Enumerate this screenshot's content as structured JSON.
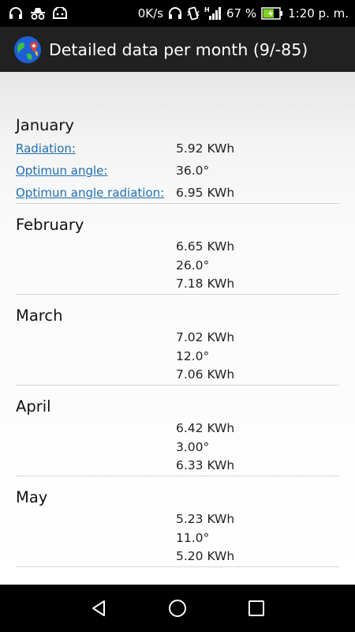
{
  "status_bar": {
    "network_speed": "0K/s",
    "battery_percent": "67 %",
    "battery_level": 0.67,
    "time": "1:20 p. m.",
    "signal_type": "H",
    "icons_left": [
      "headset-icon",
      "incognito-icon",
      "android-debug-icon"
    ],
    "icons_right": [
      "headphones-icon",
      "vibrate-icon",
      "signal-icon",
      "battery-charging-icon"
    ]
  },
  "app_bar": {
    "title": "Detailed data per month (9/-85)",
    "logo": "globe-pin-icon"
  },
  "months": [
    {
      "name": "January",
      "rows": [
        {
          "label": "Radiation:",
          "value": "5.92 KWh"
        },
        {
          "label": "Optimun angle:",
          "value": "36.0°"
        },
        {
          "label": "Optimun angle radiation:",
          "value": "6.95 KWh"
        }
      ]
    },
    {
      "name": "February",
      "rows": [
        {
          "label": "",
          "value": "6.65 KWh"
        },
        {
          "label": "",
          "value": "26.0°"
        },
        {
          "label": "",
          "value": "7.18 KWh"
        }
      ]
    },
    {
      "name": "March",
      "rows": [
        {
          "label": "",
          "value": "7.02 KWh"
        },
        {
          "label": "",
          "value": "12.0°"
        },
        {
          "label": "",
          "value": "7.06 KWh"
        }
      ]
    },
    {
      "name": "April",
      "rows": [
        {
          "label": "",
          "value": "6.42 KWh"
        },
        {
          "label": "",
          "value": "3.00°"
        },
        {
          "label": "",
          "value": "6.33 KWh"
        }
      ]
    },
    {
      "name": "May",
      "rows": [
        {
          "label": "",
          "value": "5.23 KWh"
        },
        {
          "label": "",
          "value": "11.0°"
        },
        {
          "label": "",
          "value": "5.20 KWh"
        }
      ]
    }
  ],
  "nav_bar": {
    "buttons": [
      "back-icon",
      "home-icon",
      "recents-icon"
    ]
  },
  "colors": {
    "link": "#1f6fb0",
    "app_bar": "#212121",
    "status_bar": "#000000",
    "battery_fill": "#7ed321"
  }
}
